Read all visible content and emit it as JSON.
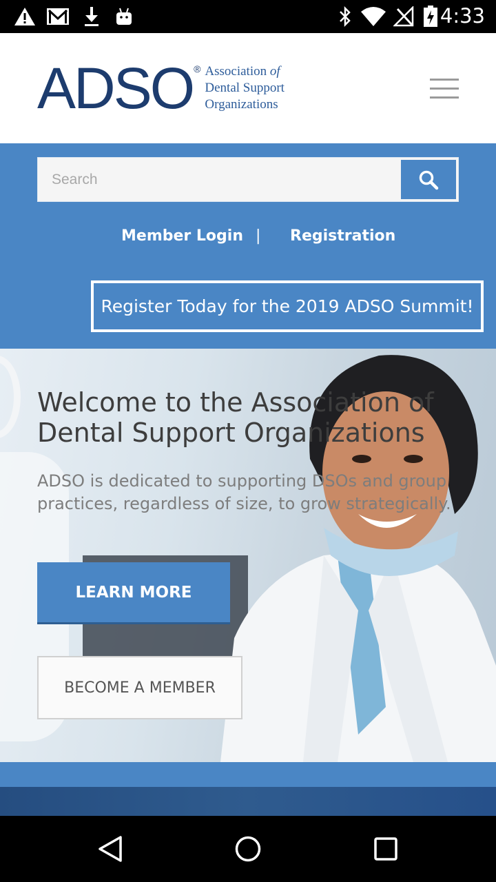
{
  "status_bar": {
    "time": "4:33",
    "icons_left": [
      "warning-icon",
      "gmail-icon",
      "download-icon",
      "android-icon"
    ],
    "icons_right": [
      "bluetooth-icon",
      "wifi-icon",
      "no-signal-icon",
      "battery-charging-icon"
    ]
  },
  "header": {
    "logo": {
      "main": "ADSO",
      "registered": "®",
      "line1": "Association",
      "line1_of": "of",
      "line2": "Dental Support",
      "line3": "Organizations"
    },
    "menu_icon": "hamburger-menu-icon"
  },
  "search": {
    "placeholder": "Search",
    "value": "",
    "button_icon": "search-icon"
  },
  "links": {
    "member_login": "Member Login",
    "separator": "|",
    "registration": "Registration"
  },
  "summit_banner": "Register Today for the 2019 ADSO Summit!",
  "hero": {
    "title": "Welcome to the Association of Dental Support Organizations",
    "subtitle": "ADSO is dedicated to supporting DSOs and group practices, regardless of size, to grow strategically.",
    "learn_more": "LEARN MORE",
    "become_member": "BECOME A MEMBER"
  },
  "colors": {
    "brand_blue": "#4a86c5",
    "logo_navy": "#1d3c6e",
    "dark_strip": "#26508a"
  },
  "nav_bar": {
    "back": "back-triangle-icon",
    "home": "home-circle-icon",
    "recents": "recents-square-icon"
  }
}
